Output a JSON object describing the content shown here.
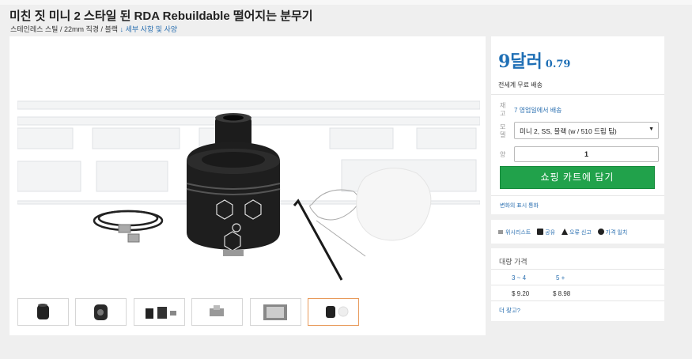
{
  "breadcrumb": "· · · · · · ·",
  "product": {
    "title": "미친 짓 미니 2 스타일 된 RDA Rebuildable 떨어지는 분무기",
    "subtitle": "스테인레스 스틸 / 22mm 직경 / 블랙",
    "details_link": "↓ 세부 사항 및 사양"
  },
  "pricing": {
    "price_main": "9달러",
    "price_cents": "0.79",
    "shipping": "전세계 무료 배송"
  },
  "form": {
    "stock_label": "재고",
    "stock_value": "7 영업일에서 배송",
    "model_label": "모델",
    "model_value": "미니 2, SS, 블랙 (w / 510 드립 팁)",
    "qty_label": "양",
    "qty_value": "1",
    "cart_button": "쇼핑 카트에 담기",
    "history_link": "변화의 표시 통화"
  },
  "actions": {
    "wishlist": "위시리스트",
    "share": "공유",
    "report": "오류 신고",
    "price_match": "가격 일치"
  },
  "bulk": {
    "title": "대량 가격",
    "tiers": [
      {
        "qty": "3 ~ 4",
        "price": "$ 9.20"
      },
      {
        "qty": "5 +",
        "price": "$ 8.98"
      }
    ],
    "faq": "더 찾고?"
  },
  "colors": {
    "accent_blue": "#1f6fb5",
    "cart_green": "#21a24b",
    "thumb_active": "#e89a5a"
  },
  "thumbnails": [
    "thumb-1",
    "thumb-2",
    "thumb-3",
    "thumb-4",
    "thumb-5",
    "thumb-6"
  ]
}
